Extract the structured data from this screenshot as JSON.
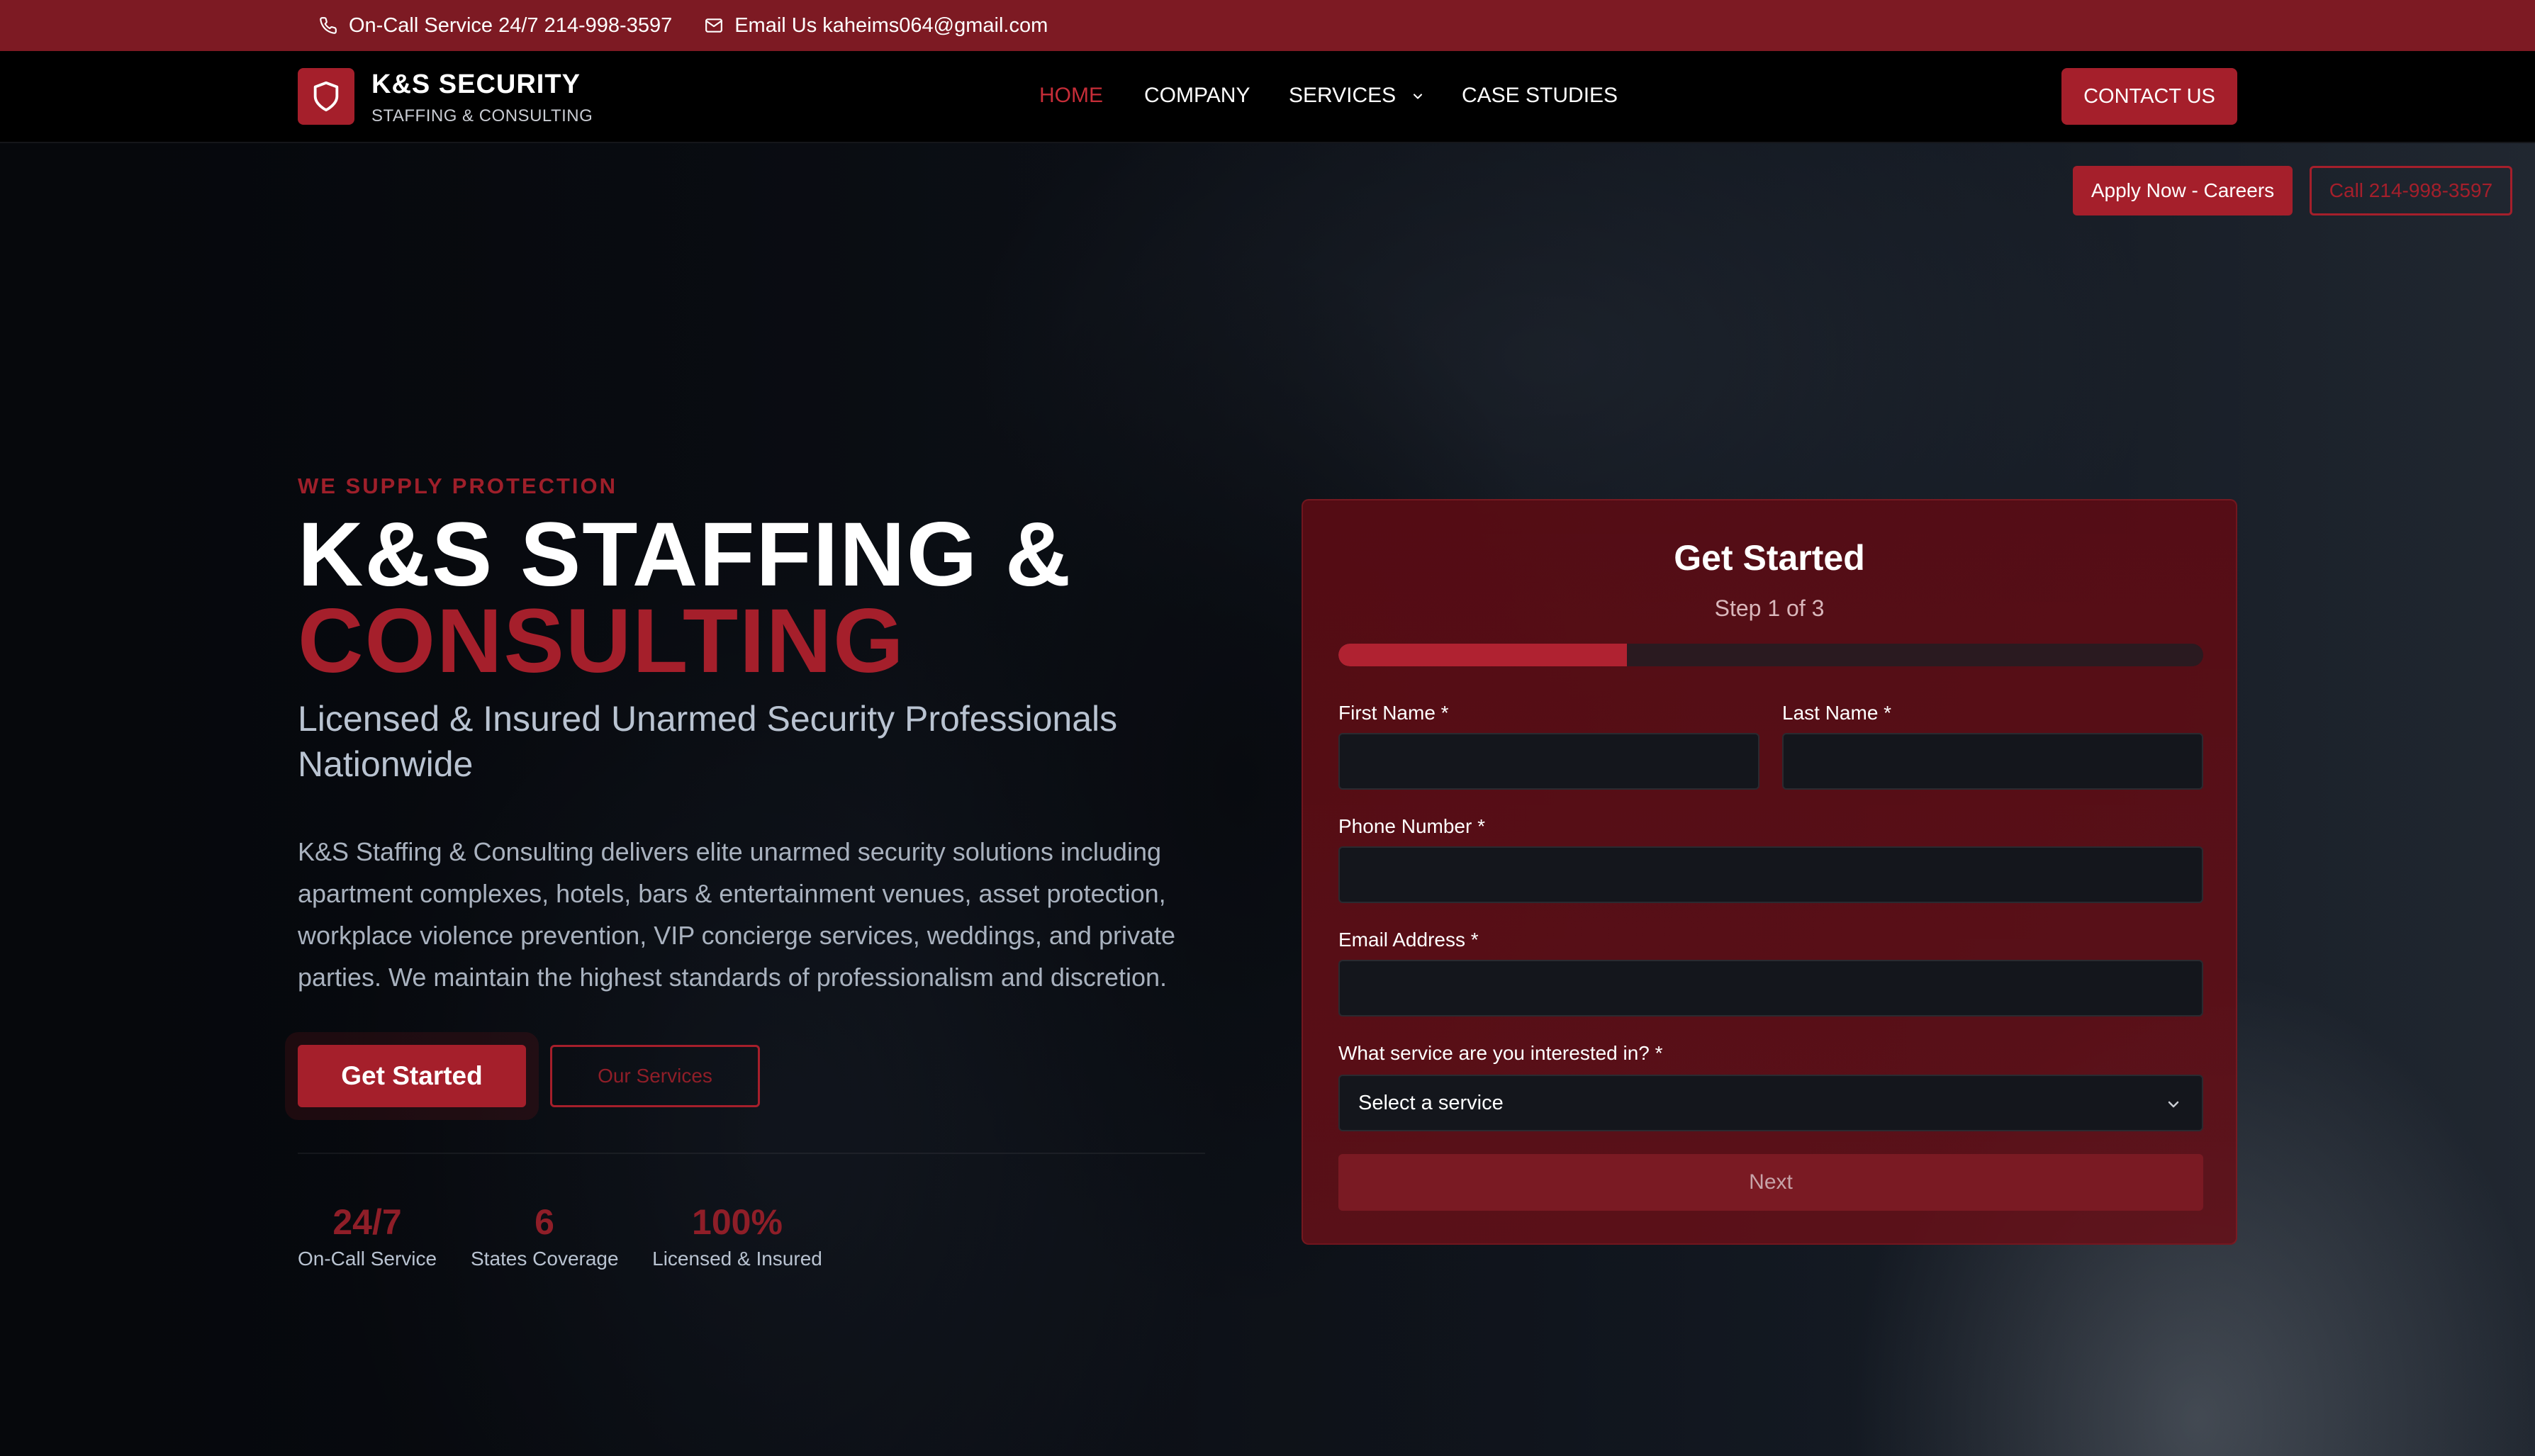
{
  "topbar": {
    "phone_text": "On-Call Service 24/7 214-998-3597",
    "email_text": "Email Us kaheims064@gmail.com"
  },
  "brand": {
    "title": "K&S SECURITY",
    "subtitle": "STAFFING & CONSULTING"
  },
  "nav": {
    "items": [
      {
        "label": "HOME",
        "active": true
      },
      {
        "label": "COMPANY"
      },
      {
        "label": "SERVICES"
      },
      {
        "label": "CASE STUDIES"
      }
    ],
    "contact_label": "CONTACT US"
  },
  "floating": {
    "apply_label": "Apply Now - Careers",
    "call_label": "Call 214-998-3597"
  },
  "hero": {
    "eyebrow": "WE SUPPLY PROTECTION",
    "headline_line1": "K&S STAFFING &",
    "headline_line2": "CONSULTING",
    "subhead": "Licensed & Insured Unarmed Security Professionals Nationwide",
    "description": "K&S Staffing & Consulting delivers elite unarmed security solutions including apartment complexes, hotels, bars & entertainment venues, asset protection, workplace violence prevention, VIP concierge services, weddings, and private parties. We maintain the highest standards of professionalism and discretion.",
    "primary_cta": "Get Started",
    "secondary_cta": "Our Services",
    "stats": [
      {
        "value": "24/7",
        "label": "On-Call Service"
      },
      {
        "value": "6",
        "label": "States Coverage"
      },
      {
        "value": "100%",
        "label": "Licensed & Insured"
      }
    ]
  },
  "form": {
    "title": "Get Started",
    "step_text": "Step 1 of 3",
    "progress_fraction": 0.3333,
    "first_name_label": "First Name *",
    "first_name_value": "",
    "last_name_label": "Last Name *",
    "last_name_value": "",
    "phone_label": "Phone Number *",
    "phone_value": "",
    "email_label": "Email Address *",
    "email_value": "",
    "service_label": "What service are you interested in? *",
    "service_selected": "Select a service",
    "next_label": "Next"
  },
  "colors": {
    "accent": "#a51f2b",
    "topbar": "#7d1a23",
    "header_bg": "#000000"
  }
}
